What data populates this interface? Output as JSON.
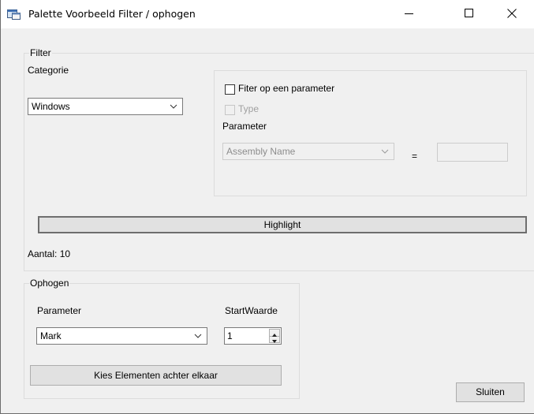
{
  "window": {
    "title": "Palette Voorbeeld Filter / ophogen"
  },
  "filter": {
    "group_title": "Filter",
    "categorie_label": "Categorie",
    "categorie_value": "Windows",
    "param_filter_checkbox_label": "Fiter op een parameter",
    "param_filter_checked": false,
    "type_checkbox_label": "Type",
    "type_checked": false,
    "parameter_label": "Parameter",
    "parameter_value": "Assembly Name",
    "equals_sign": "=",
    "value_field": "",
    "highlight_button": "Highlight",
    "count_text": "Aantal: 10"
  },
  "ophogen": {
    "group_title": "Ophogen",
    "parameter_label": "Parameter",
    "parameter_value": "Mark",
    "startwaarde_label": "StartWaarde",
    "startwaarde_value": "1",
    "kies_button": "Kies Elementen achter elkaar"
  },
  "footer": {
    "sluiten_button": "Sluiten"
  }
}
